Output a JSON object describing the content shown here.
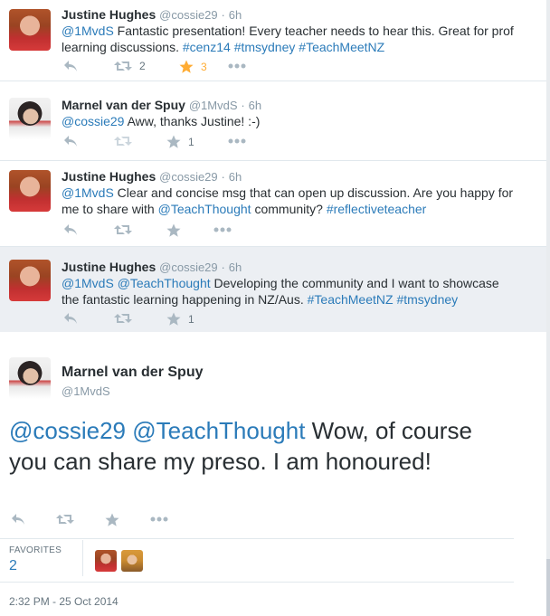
{
  "tweets": [
    {
      "name": "Justine Hughes",
      "handle": "@cossie29",
      "time": "6h",
      "text_parts": [
        {
          "t": "@1MvdS",
          "link": true
        },
        {
          "t": " Fantastic presentation! Every teacher needs to hear this. Great for prof learning discussions. ",
          "link": false
        },
        {
          "t": "#cenz14",
          "link": true
        },
        {
          "t": " ",
          "link": false
        },
        {
          "t": "#tmsydney",
          "link": true
        },
        {
          "t": " ",
          "link": false
        },
        {
          "t": "#TeachMeetNZ",
          "link": true
        }
      ],
      "retweets": "2",
      "favorites": "3"
    },
    {
      "name": "Marnel van der Spuy",
      "handle": "@1MvdS",
      "time": "6h",
      "text_parts": [
        {
          "t": "@cossie29",
          "link": true
        },
        {
          "t": " Aww, thanks Justine!  :-)",
          "link": false
        }
      ],
      "retweets": "",
      "favorites": "1"
    },
    {
      "name": "Justine Hughes",
      "handle": "@cossie29",
      "time": "6h",
      "text_parts": [
        {
          "t": "@1MvdS",
          "link": true
        },
        {
          "t": " Clear and concise msg that can open up discussion. Are you happy for me to share with ",
          "link": false
        },
        {
          "t": "@TeachThought",
          "link": true
        },
        {
          "t": " community? ",
          "link": false
        },
        {
          "t": "#reflectiveteacher",
          "link": true
        }
      ],
      "retweets": "",
      "favorites": ""
    },
    {
      "name": "Justine Hughes",
      "handle": "@cossie29",
      "time": "6h",
      "text_parts": [
        {
          "t": "@1MvdS",
          "link": true
        },
        {
          "t": " ",
          "link": false
        },
        {
          "t": "@TeachThought",
          "link": true
        },
        {
          "t": " Developing the community and I want to showcase the fantastic learning happening in NZ/Aus. ",
          "link": false
        },
        {
          "t": "#TeachMeetNZ",
          "link": true
        },
        {
          "t": " ",
          "link": false
        },
        {
          "t": "#tmsydney",
          "link": true
        }
      ],
      "retweets": "",
      "favorites": "1"
    }
  ],
  "expanded": {
    "name": "Marnel van der Spuy",
    "handle": "@1MvdS",
    "text_parts": [
      {
        "t": "@cossie29",
        "link": true
      },
      {
        "t": " ",
        "link": false
      },
      {
        "t": "@TeachThought",
        "link": true
      },
      {
        "t": " Wow, of course you can share my preso. I am honoured!",
        "link": false
      }
    ],
    "favorites_label": "FAVORITES",
    "favorites_count": "2",
    "timestamp": "2:32 PM - 25 Oct 2014"
  },
  "icons": {
    "reply": "reply-icon",
    "retweet": "retweet-icon",
    "favorite": "star-icon",
    "more": "more-icon"
  },
  "colors": {
    "link": "#2b7bb9",
    "favorited": "#ffac33",
    "action_gray": "#aab8c2"
  }
}
